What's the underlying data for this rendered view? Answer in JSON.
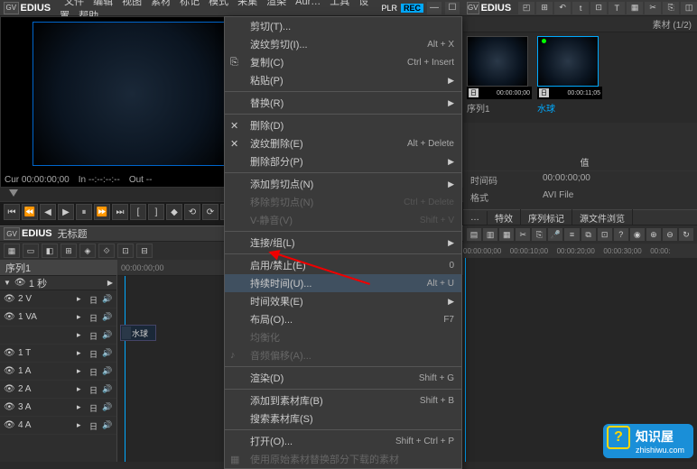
{
  "app": {
    "name": "EDIUS",
    "plr": "PLR",
    "rec": "REC"
  },
  "menu": {
    "items": [
      "文件",
      "编辑",
      "视图",
      "素材",
      "标记",
      "模式",
      "采集",
      "渲染",
      "Aur…",
      "工具",
      "设置",
      "帮助"
    ]
  },
  "preview": {
    "cur_label": "Cur",
    "cur_value": "00:00:00;00",
    "in_label": "In",
    "in_value": "--:--:--:--",
    "out_label": "Out",
    "out_value": "--"
  },
  "project": {
    "title": "无标题",
    "close_glyph": "×"
  },
  "sequence": {
    "tab_label": "序列1",
    "scale_label": "1 秒"
  },
  "ruler": {
    "start": "00:00:00;00"
  },
  "tracks": [
    {
      "name": "2 V"
    },
    {
      "name": "1 VA"
    },
    {
      "name": ""
    },
    {
      "name": "1 T"
    },
    {
      "name": "1 A"
    },
    {
      "name": "2 A"
    },
    {
      "name": "3 A"
    },
    {
      "name": "4 A"
    }
  ],
  "clip": {
    "label": "水球"
  },
  "context_menu": [
    {
      "type": "item",
      "label": "剪切(T)...",
      "icon": ""
    },
    {
      "type": "item",
      "label": "波纹剪切(I)...",
      "shortcut": "Alt + X",
      "icon": ""
    },
    {
      "type": "item",
      "label": "复制(C)",
      "shortcut": "Ctrl + Insert",
      "icon": "⎘"
    },
    {
      "type": "item",
      "label": "粘贴(P)",
      "arrow": true
    },
    {
      "type": "sep"
    },
    {
      "type": "item",
      "label": "替换(R)",
      "arrow": true
    },
    {
      "type": "sep"
    },
    {
      "type": "item",
      "label": "删除(D)",
      "icon": "✕"
    },
    {
      "type": "item",
      "label": "波纹删除(E)",
      "shortcut": "Alt + Delete",
      "icon": "✕"
    },
    {
      "type": "item",
      "label": "删除部分(P)",
      "arrow": true
    },
    {
      "type": "sep"
    },
    {
      "type": "item",
      "label": "添加剪切点(N)",
      "arrow": true
    },
    {
      "type": "item",
      "label": "移除剪切点(N)",
      "shortcut": "Ctrl + Delete",
      "disabled": true
    },
    {
      "type": "item",
      "label": "V-静音(V)",
      "shortcut": "Shift + V",
      "disabled": true
    },
    {
      "type": "sep"
    },
    {
      "type": "item",
      "label": "连接/组(L)",
      "arrow": true
    },
    {
      "type": "sep"
    },
    {
      "type": "item",
      "label": "启用/禁止(E)",
      "shortcut": "0"
    },
    {
      "type": "item",
      "label": "持续时间(U)...",
      "shortcut": "Alt + U",
      "highlighted": true
    },
    {
      "type": "item",
      "label": "时间效果(E)",
      "arrow": true
    },
    {
      "type": "item",
      "label": "布局(O)...",
      "shortcut": "F7"
    },
    {
      "type": "item",
      "label": "均衡化",
      "disabled": true
    },
    {
      "type": "item",
      "label": "音频偏移(A)...",
      "disabled": true,
      "icon": "♪"
    },
    {
      "type": "sep"
    },
    {
      "type": "item",
      "label": "渲染(D)",
      "shortcut": "Shift + G"
    },
    {
      "type": "sep"
    },
    {
      "type": "item",
      "label": "添加到素材库(B)",
      "shortcut": "Shift + B"
    },
    {
      "type": "item",
      "label": "搜索素材库(S)"
    },
    {
      "type": "sep"
    },
    {
      "type": "item",
      "label": "打开(O)...",
      "shortcut": "Shift + Ctrl + P"
    },
    {
      "type": "item",
      "label": "使用原始素材替换部分下载的素材",
      "disabled": true,
      "icon": "▦"
    }
  ],
  "right_panel": {
    "app_name": "EDIUS",
    "breadcrumb": "素材 (1/2)",
    "thumbs": [
      {
        "label": "序列1",
        "time": "00:00:00;00",
        "tag": "日",
        "selected": false,
        "green": false
      },
      {
        "label": "水球",
        "time": "00:00:11;05",
        "tag": "日",
        "selected": true,
        "green": true
      }
    ],
    "prop_header": "值",
    "props": [
      {
        "k": "时间码",
        "v": "00:00:00;00"
      },
      {
        "k": "格式",
        "v": "AVI File"
      }
    ],
    "tabs": [
      "…",
      "特效",
      "序列标记",
      "源文件浏览"
    ],
    "ruler_ticks": [
      "00:00:00;00",
      "00:00:10;00",
      "00:00:20;00",
      "00:00:30;00",
      "00:00:"
    ]
  },
  "watermark": {
    "title": "知识屋",
    "url": "zhishiwu.com",
    "q": "?"
  }
}
